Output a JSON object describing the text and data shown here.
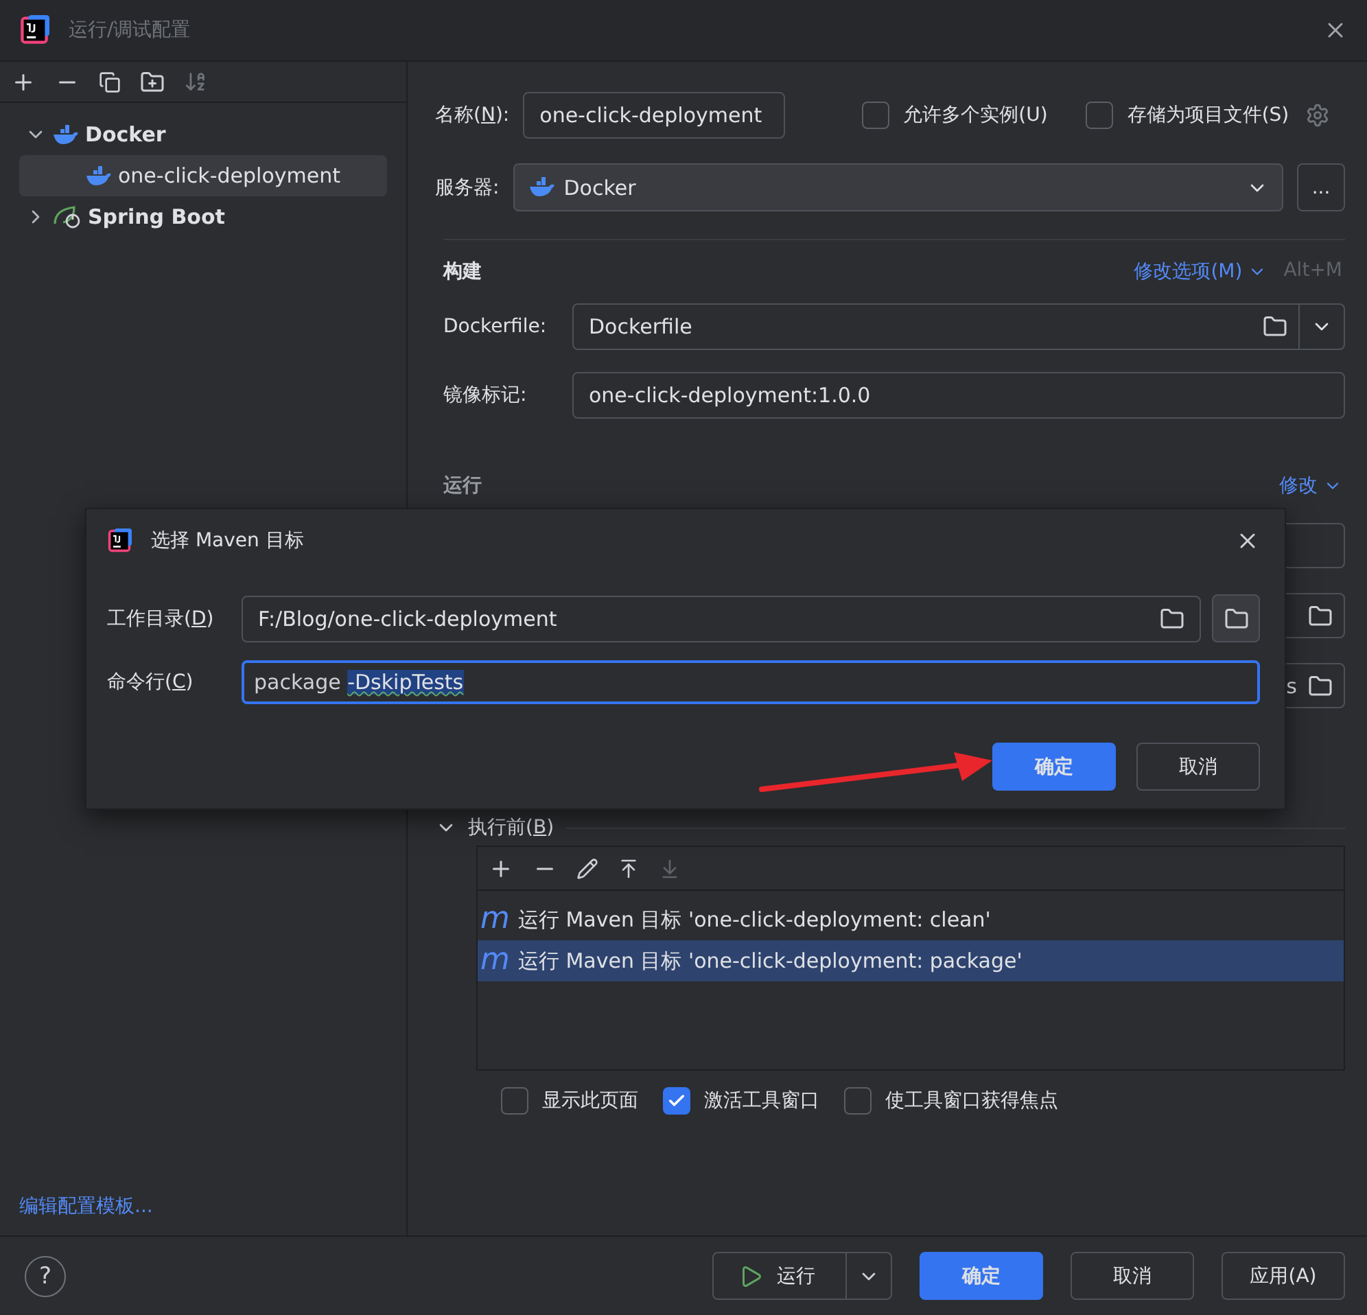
{
  "window": {
    "title": "运行/调试配置"
  },
  "sidebar": {
    "tree": [
      {
        "label": "Docker",
        "kind": "docker",
        "expanded": true,
        "selected": false,
        "children": [
          {
            "label": "one-click-deployment",
            "kind": "docker",
            "selected": true
          }
        ]
      },
      {
        "label": "Spring Boot",
        "kind": "spring",
        "expanded": false,
        "selected": false
      }
    ],
    "template_link": "编辑配置模板..."
  },
  "form": {
    "name": {
      "label": {
        "before": "名称(",
        "key": "N",
        "after": "):"
      },
      "value": "one-click-deployment"
    },
    "options": [
      {
        "label": "允许多个实例(U)",
        "checked": false
      },
      {
        "label": "存储为项目文件(S)",
        "checked": false
      }
    ],
    "server": {
      "label": "服务器:",
      "value": "Docker",
      "more": "..."
    },
    "build": {
      "title": "构建",
      "modify": "修改选项(M)",
      "shortcut": "Alt+M",
      "dockerfile": {
        "label": "Dockerfile:",
        "value": "Dockerfile"
      },
      "image_tag": {
        "label": "镜像标记:",
        "value": "one-click-deployment:1.0.0"
      }
    },
    "run": {
      "title": "运行",
      "modify": "修改",
      "field_3_value": "s"
    },
    "before_launch": {
      "label": {
        "before": "执行前(",
        "key": "B",
        "after": ")"
      },
      "expanded": true,
      "tasks": [
        {
          "icon": "m",
          "label": "运行 Maven 目标 'one-click-deployment: clean'",
          "selected": false
        },
        {
          "icon": "m",
          "label": "运行 Maven 目标 'one-click-deployment: package'",
          "selected": true
        }
      ]
    },
    "checkboxes": [
      {
        "label": "显示此页面",
        "checked": false
      },
      {
        "label": "激活工具窗口",
        "checked": true
      },
      {
        "label": "使工具窗口获得焦点",
        "checked": false
      }
    ]
  },
  "dialog": {
    "title": "选择 Maven 目标",
    "workdir": {
      "label": {
        "before": "工作目录(",
        "key": "D",
        "after": ")"
      },
      "value": "F:/Blog/one-click-deployment"
    },
    "command": {
      "label": {
        "before": "命令行(",
        "key": "C",
        "after": ")"
      },
      "value_before": "package ",
      "value_selected": "-DskipTests"
    },
    "buttons": [
      {
        "label": "确定",
        "primary": true
      },
      {
        "label": "取消",
        "primary": false
      }
    ]
  },
  "footer": {
    "help": "?",
    "buttons": [
      {
        "label": "运行",
        "kind": "split"
      },
      {
        "label": "确定",
        "kind": "primary"
      },
      {
        "label": "取消",
        "kind": "plain"
      },
      {
        "label": "应用(A)",
        "kind": "plain"
      }
    ]
  }
}
